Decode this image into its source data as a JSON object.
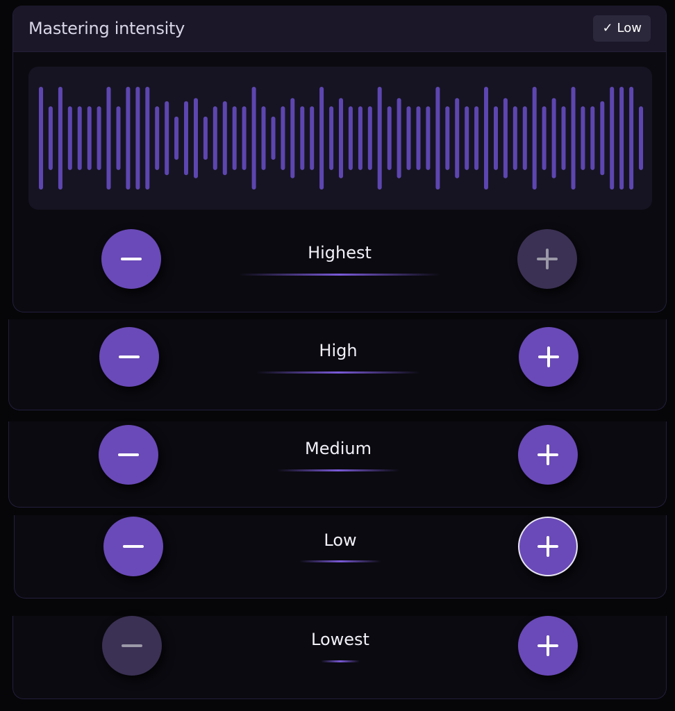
{
  "header": {
    "title": "Mastering intensity",
    "badge_check": "✓",
    "badge_label": "Low"
  },
  "waveform": {
    "color": "#5d46b0",
    "bar_levels": [
      1.0,
      0.62,
      1.0,
      0.62,
      0.62,
      0.62,
      0.62,
      1.0,
      0.62,
      1.0,
      1.0,
      1.0,
      0.62,
      0.72,
      0.42,
      0.72,
      0.78,
      0.42,
      0.62,
      0.72,
      0.62,
      0.62,
      1.0,
      0.62,
      0.42,
      0.62,
      0.78,
      0.62,
      0.62,
      1.0,
      0.62,
      0.78,
      0.62,
      0.62,
      0.62,
      1.0,
      0.62,
      0.78,
      0.62,
      0.62,
      0.62,
      1.0,
      0.62,
      0.78,
      0.62,
      0.62,
      1.0,
      0.62,
      0.78,
      0.62,
      0.62,
      1.0,
      0.62,
      0.78,
      0.62,
      1.0,
      0.62,
      0.62,
      0.72,
      1.0,
      1.0,
      1.0,
      0.62
    ]
  },
  "levels": [
    {
      "key": "highest",
      "label": "Highest",
      "minus_disabled": false,
      "plus_disabled": true,
      "plus_focused": false
    },
    {
      "key": "high",
      "label": "High",
      "minus_disabled": false,
      "plus_disabled": false,
      "plus_focused": false
    },
    {
      "key": "medium",
      "label": "Medium",
      "minus_disabled": false,
      "plus_disabled": false,
      "plus_focused": false
    },
    {
      "key": "low",
      "label": "Low",
      "minus_disabled": false,
      "plus_disabled": false,
      "plus_focused": true
    },
    {
      "key": "lowest",
      "label": "Lowest",
      "minus_disabled": true,
      "plus_disabled": false,
      "plus_focused": false
    }
  ],
  "colors": {
    "accent": "#6a4ab8",
    "accent_disabled": "#3b3154",
    "header_bg": "#1b1729",
    "waveform_bg": "#161422"
  },
  "icons": {
    "minus": "minus-icon",
    "plus": "plus-icon",
    "check": "checkmark-icon"
  }
}
